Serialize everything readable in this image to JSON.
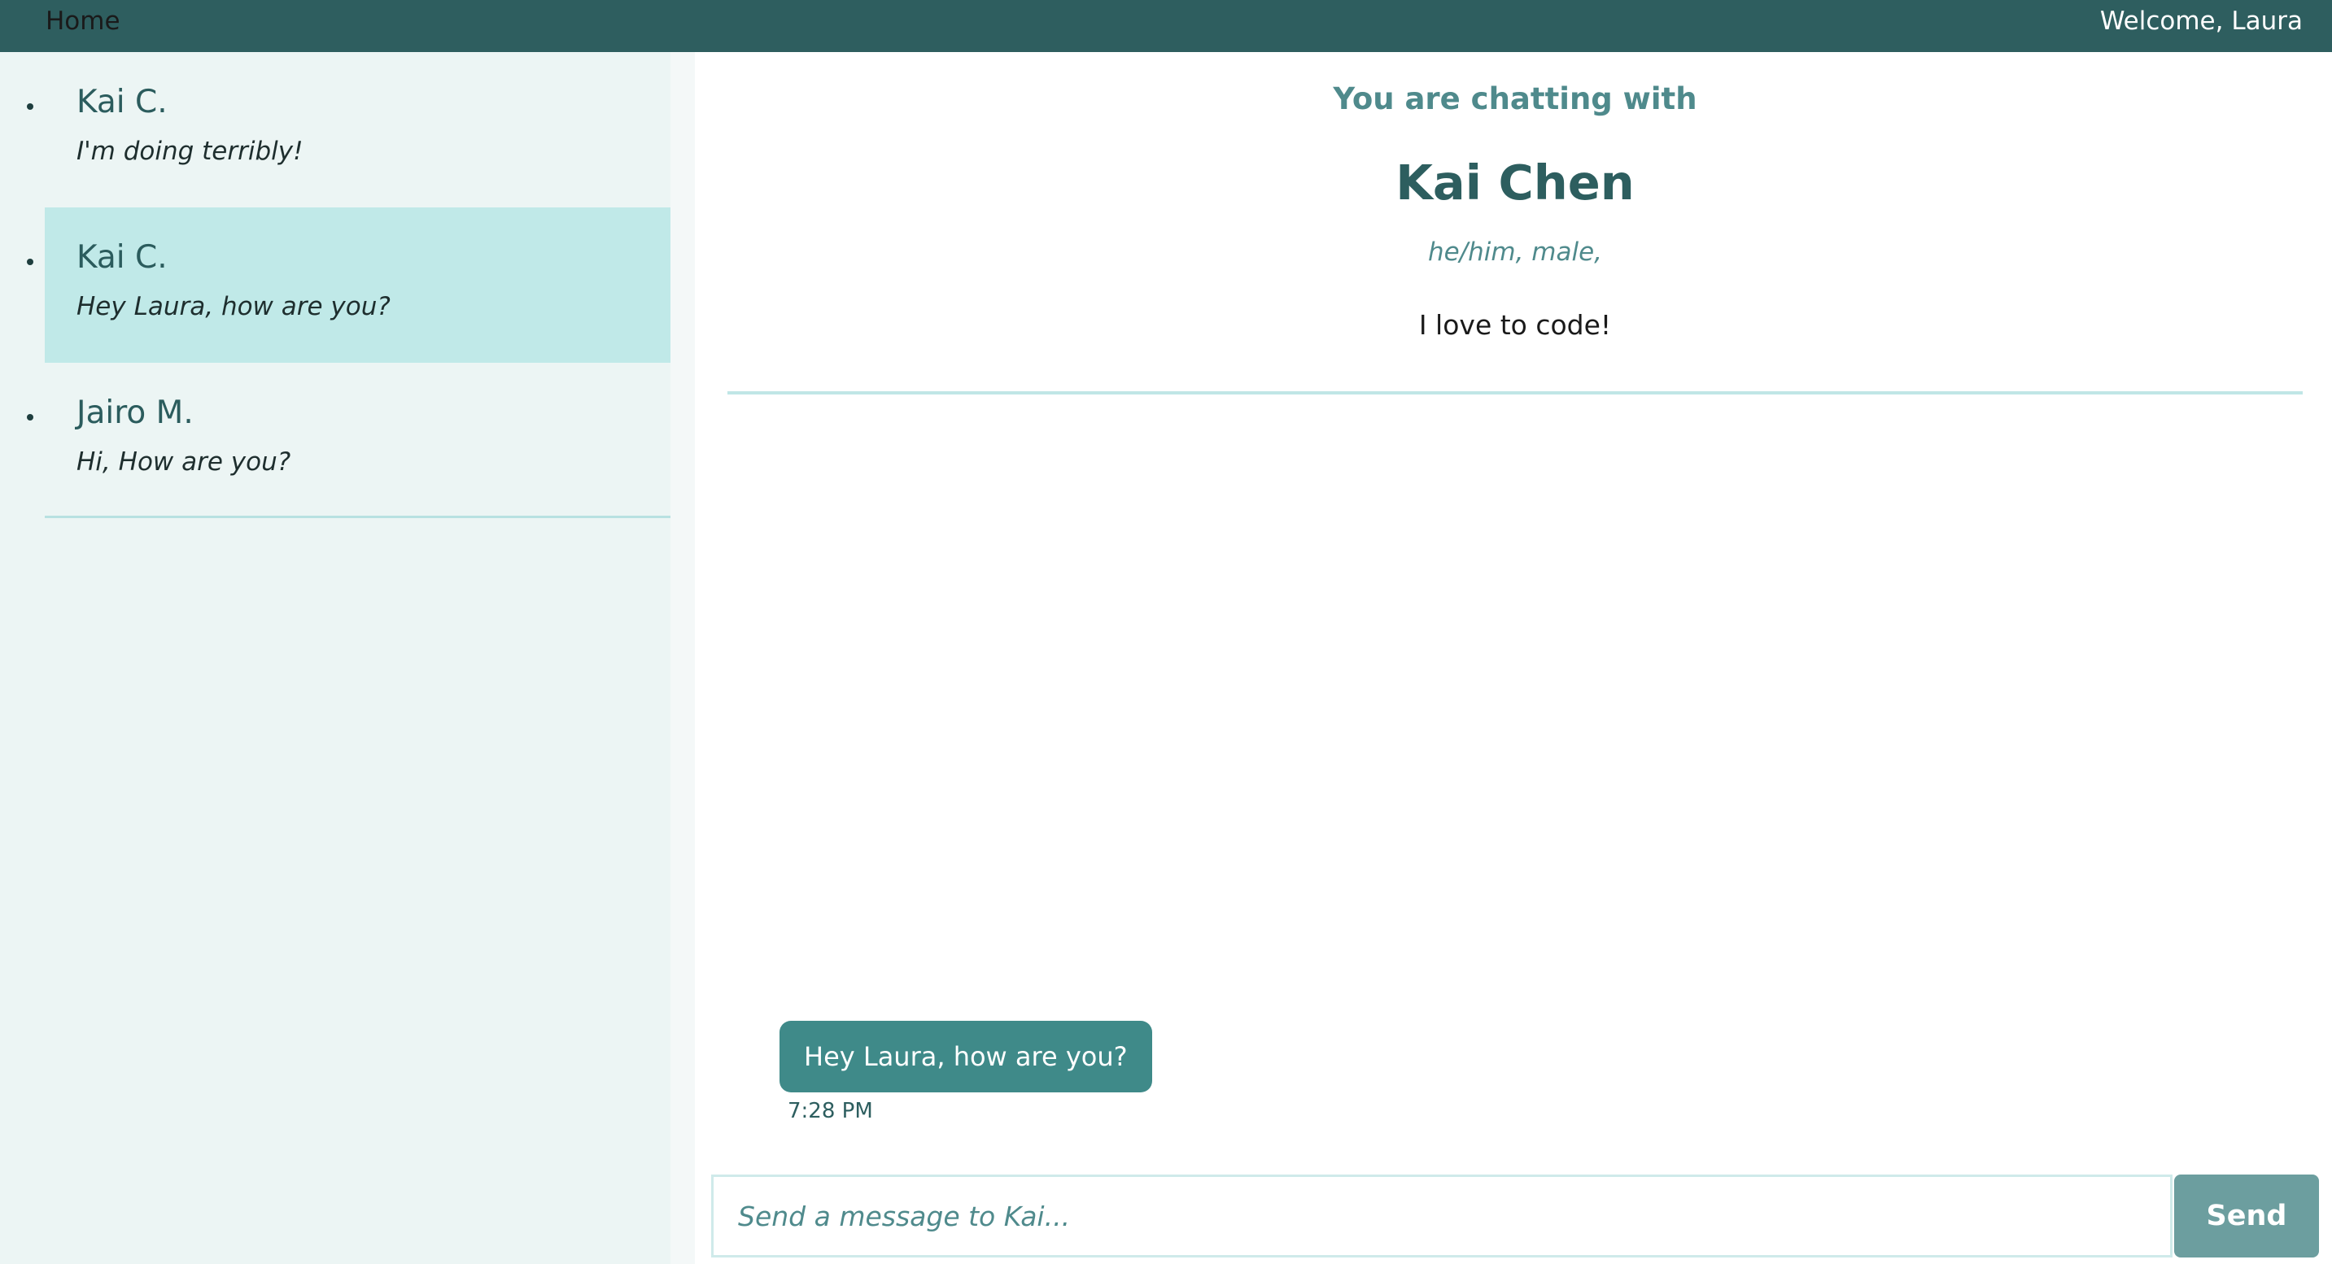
{
  "topbar": {
    "home_label": "Home",
    "welcome_text": "Welcome, Laura"
  },
  "sidebar": {
    "conversations": [
      {
        "name": "Kai C.",
        "preview": "I'm doing terribly!",
        "active": false
      },
      {
        "name": "Kai C.",
        "preview": "Hey Laura, how are you?",
        "active": true
      },
      {
        "name": "Jairo M.",
        "preview": "Hi, How are you?",
        "active": false
      }
    ]
  },
  "chat": {
    "lead": "You are chatting with",
    "name": "Kai Chen",
    "pronouns": "he/him, male,",
    "bio": "I love to code!",
    "messages": [
      {
        "text": "Hey Laura, how are you?",
        "time": "7:28 PM"
      }
    ]
  },
  "composer": {
    "placeholder": "Send a message to Kai...",
    "value": "",
    "send_label": "Send"
  },
  "colors": {
    "topbar": "#2e5e5f",
    "sidebar_bg": "#ecf5f4",
    "active_item": "#c0e9e8",
    "bubble": "#3f8a89",
    "send_button": "#6c9e9f",
    "accent_text": "#4f8a8c"
  }
}
